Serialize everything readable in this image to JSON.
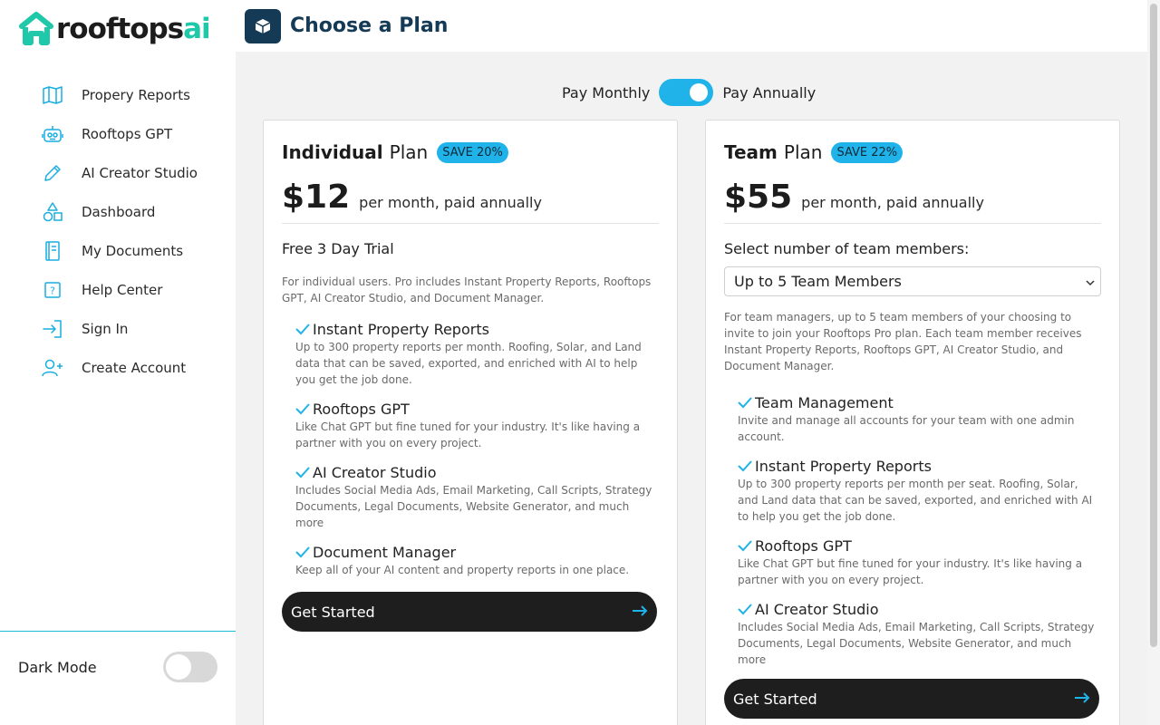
{
  "brand": {
    "logo_main": "rooftops",
    "logo_accent": "ai",
    "accent_color": "#1ec8a8"
  },
  "header": {
    "title": "Choose a Plan",
    "icon": "box-icon"
  },
  "sidebar": {
    "items": [
      {
        "label": "Propery Reports",
        "icon": "map-icon"
      },
      {
        "label": "Rooftops GPT",
        "icon": "robot-icon"
      },
      {
        "label": "AI Creator Studio",
        "icon": "pencil-icon"
      },
      {
        "label": "Dashboard",
        "icon": "shapes-icon"
      },
      {
        "label": "My Documents",
        "icon": "book-icon"
      },
      {
        "label": "Help Center",
        "icon": "help-icon"
      },
      {
        "label": "Sign In",
        "icon": "sign-in-icon"
      },
      {
        "label": "Create Account",
        "icon": "add-user-icon"
      }
    ],
    "dark_mode_label": "Dark Mode",
    "dark_mode_on": false
  },
  "billing": {
    "monthly_label": "Pay Monthly",
    "annual_label": "Pay Annually",
    "annual_selected": true,
    "toggle_color": "#1fb3ea"
  },
  "plans": {
    "individual": {
      "name": "Individual",
      "plan_word": "Plan",
      "badge": "SAVE 20%",
      "price": "$12",
      "price_note": "per month, paid annually",
      "trial": "Free 3 Day Trial",
      "description": "For individual users. Pro includes Instant Property Reports, Rooftops GPT, AI Creator Studio, and Document Manager.",
      "features": [
        {
          "title": "Instant Property Reports",
          "desc": "Up to 300 property reports per month. Roofing, Solar, and Land data that can be saved, exported, and enriched with AI to help you get the job done."
        },
        {
          "title": "Rooftops GPT",
          "desc": "Like Chat GPT but fine tuned for your industry. It's like having a partner with you on every project."
        },
        {
          "title": "AI Creator Studio",
          "desc": "Includes Social Media Ads, Email Marketing, Call Scripts, Strategy Documents, Legal Documents, Website Generator, and much more"
        },
        {
          "title": "Document Manager",
          "desc": "Keep all of your AI content and property reports in one place."
        }
      ],
      "cta": "Get Started"
    },
    "team": {
      "name": "Team",
      "plan_word": "Plan",
      "badge": "SAVE 22%",
      "price": "$55",
      "price_note": "per month, paid annually",
      "select_label": "Select number of team members:",
      "select_value": "Up to 5 Team Members",
      "description": "For team managers, up to 5 team members of your choosing to invite to join your Rooftops Pro plan. Each team member receives Instant Property Reports, Rooftops GPT, AI Creator Studio, and Document Manager.",
      "features": [
        {
          "title": "Team Management",
          "desc": "Invite and manage all accounts for your team with one admin account."
        },
        {
          "title": "Instant Property Reports",
          "desc": "Up to 300 property reports per month per seat. Roofing, Solar, and Land data that can be saved, exported, and enriched with AI to help you get the job done."
        },
        {
          "title": "Rooftops GPT",
          "desc": "Like Chat GPT but fine tuned for your industry. It's like having a partner with you on every project."
        },
        {
          "title": "AI Creator Studio",
          "desc": "Includes Social Media Ads, Email Marketing, Call Scripts, Strategy Documents, Legal Documents, Website Generator, and much more"
        }
      ],
      "cta": "Get Started"
    }
  }
}
